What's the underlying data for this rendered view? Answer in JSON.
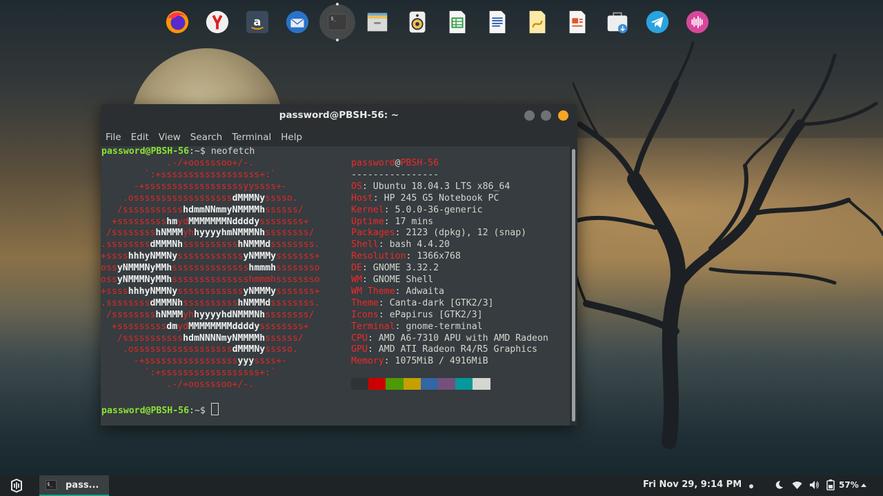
{
  "dock": {
    "apps": [
      {
        "name": "firefox",
        "icon": "firefox-icon",
        "active": false
      },
      {
        "name": "yandex",
        "icon": "yandex-browser-icon",
        "active": false
      },
      {
        "name": "amazon",
        "icon": "amazon-icon",
        "active": false
      },
      {
        "name": "thunderbird",
        "icon": "thunderbird-icon",
        "active": false
      },
      {
        "name": "terminal",
        "icon": "terminal-icon",
        "active": true
      },
      {
        "name": "files",
        "icon": "file-manager-icon",
        "active": false
      },
      {
        "name": "rhythmbox",
        "icon": "speaker-icon",
        "active": false
      },
      {
        "name": "calc",
        "icon": "spreadsheet-icon",
        "active": false
      },
      {
        "name": "writer",
        "icon": "document-icon",
        "active": false
      },
      {
        "name": "draw",
        "icon": "draw-icon",
        "active": false
      },
      {
        "name": "impress",
        "icon": "presentation-icon",
        "active": false
      },
      {
        "name": "store",
        "icon": "software-store-icon",
        "active": false
      },
      {
        "name": "telegram",
        "icon": "telegram-icon",
        "active": false
      },
      {
        "name": "podcasts",
        "icon": "podcast-icon",
        "active": false
      }
    ]
  },
  "terminal": {
    "title": "password@PBSH-56: ~",
    "menu": [
      "File",
      "Edit",
      "View",
      "Search",
      "Terminal",
      "Help"
    ],
    "prompt_user": "password@PBSH-56",
    "prompt_path": ":~$",
    "command": " neofetch",
    "info_user": "password",
    "info_at": "@",
    "info_host": "PBSH-56",
    "separator": "----------------",
    "info": [
      {
        "key": "OS",
        "value": "Ubuntu 18.04.3 LTS x86_64"
      },
      {
        "key": "Host",
        "value": "HP 245 G5 Notebook PC"
      },
      {
        "key": "Kernel",
        "value": "5.0.0-36-generic"
      },
      {
        "key": "Uptime",
        "value": "17 mins"
      },
      {
        "key": "Packages",
        "value": "2123 (dpkg), 12 (snap)"
      },
      {
        "key": "Shell",
        "value": "bash 4.4.20"
      },
      {
        "key": "Resolution",
        "value": "1366x768"
      },
      {
        "key": "DE",
        "value": "GNOME 3.32.2"
      },
      {
        "key": "WM",
        "value": "GNOME Shell"
      },
      {
        "key": "WM Theme",
        "value": "Adwaita"
      },
      {
        "key": "Theme",
        "value": "Canta-dark [GTK2/3]"
      },
      {
        "key": "Icons",
        "value": "ePapirus [GTK2/3]"
      },
      {
        "key": "Terminal",
        "value": "gnome-terminal"
      },
      {
        "key": "CPU",
        "value": "AMD A6-7310 APU with AMD Radeon"
      },
      {
        "key": "GPU",
        "value": "AMD ATI Radeon R4/R5 Graphics"
      },
      {
        "key": "Memory",
        "value": "1075MiB / 4916MiB"
      }
    ],
    "palette": [
      "#2e3436",
      "#cc0000",
      "#4e9a06",
      "#c4a000",
      "#3465a4",
      "#75507b",
      "#06989a",
      "#d3d7cf"
    ],
    "ascii_art": [
      [
        [
          "r",
          "            .-/+oossssoo+/-."
        ]
      ],
      [
        [
          "r",
          "        `:+ssssssssssssssssss+:`"
        ]
      ],
      [
        [
          "r",
          "      -+ssssssssssssssssssyyssss+-"
        ]
      ],
      [
        [
          "r",
          "    .ossssssssssssssssss"
        ],
        [
          "w",
          "dMMMNy"
        ],
        [
          "r",
          "sssso."
        ]
      ],
      [
        [
          "r",
          "   /sssssssssss"
        ],
        [
          "w",
          "hdmmNNmmyNMMMMh"
        ],
        [
          "r",
          "ssssss/"
        ]
      ],
      [
        [
          "r",
          "  +sssssssss"
        ],
        [
          "w",
          "hm"
        ],
        [
          "r",
          "yd"
        ],
        [
          "w",
          "MMMMMMMNddddy"
        ],
        [
          "r",
          "ssssssss+"
        ]
      ],
      [
        [
          "r",
          " /ssssssss"
        ],
        [
          "w",
          "hNMMM"
        ],
        [
          "r",
          "yh"
        ],
        [
          "w",
          "hyyyyhmNMMMNh"
        ],
        [
          "r",
          "ssssssss/"
        ]
      ],
      [
        [
          "r",
          ".ssssssss"
        ],
        [
          "w",
          "dMMMNh"
        ],
        [
          "r",
          "ssssssssss"
        ],
        [
          "w",
          "hNMMMd"
        ],
        [
          "r",
          "ssssssss."
        ]
      ],
      [
        [
          "r",
          "+ssss"
        ],
        [
          "w",
          "hhhyNMMNy"
        ],
        [
          "r",
          "ssssssssssss"
        ],
        [
          "w",
          "yNMMMy"
        ],
        [
          "r",
          "sssssss+"
        ]
      ],
      [
        [
          "r",
          "oss"
        ],
        [
          "w",
          "yNMMMNyMMh"
        ],
        [
          "r",
          "ssssssssssssss"
        ],
        [
          "w",
          "hmmmh"
        ],
        [
          "r",
          "ssssssso"
        ]
      ],
      [
        [
          "r",
          "oss"
        ],
        [
          "w",
          "yNMMMNyMMh"
        ],
        [
          "r",
          "sssssssssssssshmmmhssssssso"
        ]
      ],
      [
        [
          "r",
          "+ssss"
        ],
        [
          "w",
          "hhhyNMMNy"
        ],
        [
          "r",
          "ssssssssssss"
        ],
        [
          "w",
          "yNMMMy"
        ],
        [
          "r",
          "sssssss+"
        ]
      ],
      [
        [
          "r",
          ".ssssssss"
        ],
        [
          "w",
          "dMMMNh"
        ],
        [
          "r",
          "ssssssssss"
        ],
        [
          "w",
          "hNMMMd"
        ],
        [
          "r",
          "ssssssss."
        ]
      ],
      [
        [
          "r",
          " /ssssssss"
        ],
        [
          "w",
          "hNMMM"
        ],
        [
          "r",
          "yh"
        ],
        [
          "w",
          "hyyyyhdNMMMNh"
        ],
        [
          "r",
          "ssssssss/"
        ]
      ],
      [
        [
          "r",
          "  +sssssssss"
        ],
        [
          "w",
          "dm"
        ],
        [
          "r",
          "yd"
        ],
        [
          "w",
          "MMMMMMMMddddy"
        ],
        [
          "r",
          "ssssssss+"
        ]
      ],
      [
        [
          "r",
          "   /sssssssssss"
        ],
        [
          "w",
          "hdmNNNNmyNMMMMh"
        ],
        [
          "r",
          "ssssss/"
        ]
      ],
      [
        [
          "r",
          "    .ossssssssssssssssss"
        ],
        [
          "w",
          "dMMMNy"
        ],
        [
          "r",
          "sssso."
        ]
      ],
      [
        [
          "r",
          "      -+sssssssssssssssss"
        ],
        [
          "w",
          "yyy"
        ],
        [
          "r",
          "ssss+-"
        ]
      ],
      [
        [
          "r",
          "        `:+ssssssssssssssssss+:`"
        ]
      ],
      [
        [
          "r",
          "            .-/+oossssoo+/-."
        ]
      ]
    ],
    "prompt2_user": "password@PBSH-56",
    "prompt2_path": ":~$"
  },
  "taskbar": {
    "task_label": "pass...",
    "task_icon_text": "$_",
    "clock": "Fri Nov 29,  9:14 PM",
    "battery": "57%"
  }
}
